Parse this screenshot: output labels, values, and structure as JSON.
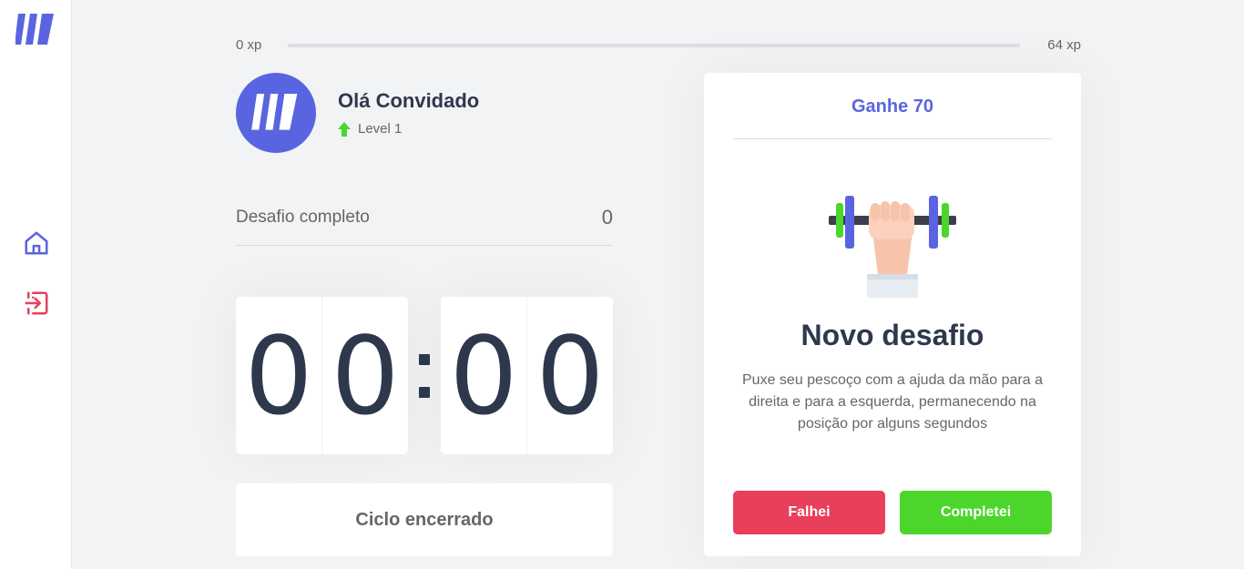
{
  "sidebar": {
    "logo_icon": "moveit-logo-icon",
    "home_icon": "home-icon",
    "logout_icon": "logout-icon",
    "home_color": "#5965e0",
    "logout_color": "#e83f5b"
  },
  "xp": {
    "current_label": "0 xp",
    "next_level_label": "64 xp",
    "progress_fraction": 0
  },
  "profile": {
    "name": "Olá Convidado",
    "level_label": "Level 1",
    "level_icon": "arrow-up-icon"
  },
  "completed_challenges": {
    "label": "Desafio completo",
    "value": "0"
  },
  "countdown": {
    "minute_left": "0",
    "minute_right": "0",
    "second_left": "0",
    "second_right": "0"
  },
  "cycle_button": {
    "label": "Ciclo encerrado"
  },
  "challenge": {
    "reward_label": "Ganhe 70",
    "illustration_icon": "dumbbell-body-icon",
    "title": "Novo desafio",
    "description": "Puxe seu pescoço com a ajuda da mão para a direita e para a esquerda, permanecendo na posição por alguns segundos",
    "fail_label": "Falhei",
    "complete_label": "Completei"
  },
  "colors": {
    "brand": "#5965e0",
    "success": "#4cd62b",
    "danger": "#e83f5b",
    "title_text": "#2e384d",
    "body_text": "#666666",
    "background": "#f2f3f5"
  }
}
